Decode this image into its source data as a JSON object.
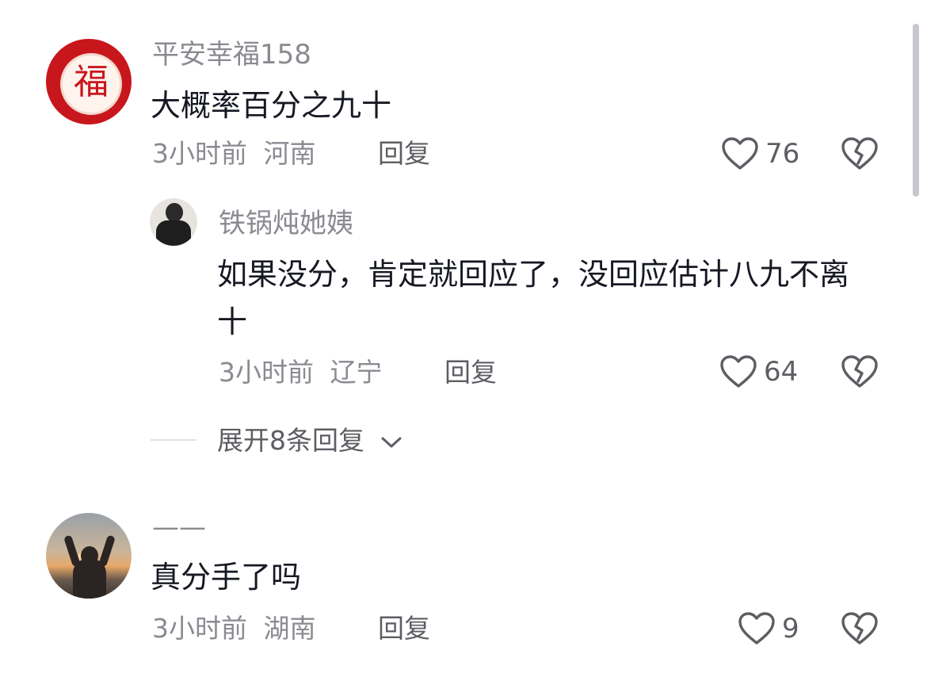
{
  "comments": [
    {
      "username": "平安幸福158",
      "avatar_glyph": "福",
      "text": "大概率百分之九十",
      "time": "3小时前",
      "location": "河南",
      "reply_label": "回复",
      "likes": "76"
    },
    {
      "username": "铁锅炖她姨",
      "text": "如果没分，肯定就回应了，没回应估计八九不离十",
      "time": "3小时前",
      "location": "辽宁",
      "reply_label": "回复",
      "likes": "64"
    },
    {
      "username": "——",
      "text": "真分手了吗",
      "time": "3小时前",
      "location": "湖南",
      "reply_label": "回复",
      "likes": "9"
    }
  ],
  "expand": {
    "label": "展开8条回复"
  },
  "icons": {
    "like": "heart-outline-icon",
    "dislike": "broken-heart-icon",
    "expand": "chevron-down-icon"
  },
  "colors": {
    "avatar_red": "#c8161d",
    "muted_text": "#8a8b91",
    "main_text": "#161823"
  }
}
